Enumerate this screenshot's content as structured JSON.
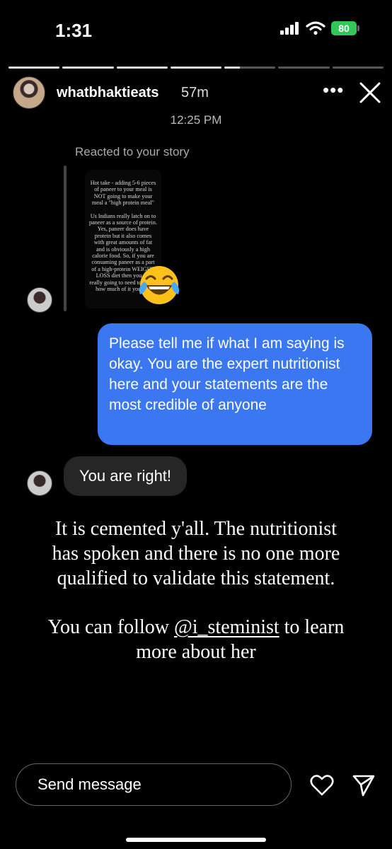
{
  "status_bar": {
    "time": "1:31",
    "battery": "80"
  },
  "story": {
    "segments_filled": [
      1,
      1,
      1,
      1,
      0.3,
      0,
      0
    ],
    "username": "whatbhaktieats",
    "age": "57m"
  },
  "conversation": {
    "timestamp": "12:25 PM",
    "reacted_label": "Reacted to your story",
    "story_preview": {
      "para1": "Hot take - adding 5-6 pieces of paneer to your meal is NOT going to make your meal a \"high protein meal\"",
      "para2": "Us Indians really latch on to paneer as a source of protein. Yes, paneer does have protein but it also comes with great amounts of fat and is obviously a high calorie food. So, if you are consuming paneer as a part of a high-protein WEIGHT LOSS diet then you are really going to need to watch how much of it you eat."
    },
    "reaction_emoji": "face-with-tears-of-joy",
    "sent_message": "Please tell me if what I am saying is okay. You are the expert nutritionist here and your statements are the most credible of anyone",
    "received_message": "You are right!"
  },
  "caption": {
    "para1": "It is cemented y'all. The nutritionist has spoken and there is no one more qualified to validate this statement.",
    "para2_before": "You can follow ",
    "mention": "@i_steminist",
    "para2_after": " to learn more about her"
  },
  "composer": {
    "placeholder": "Send message"
  }
}
